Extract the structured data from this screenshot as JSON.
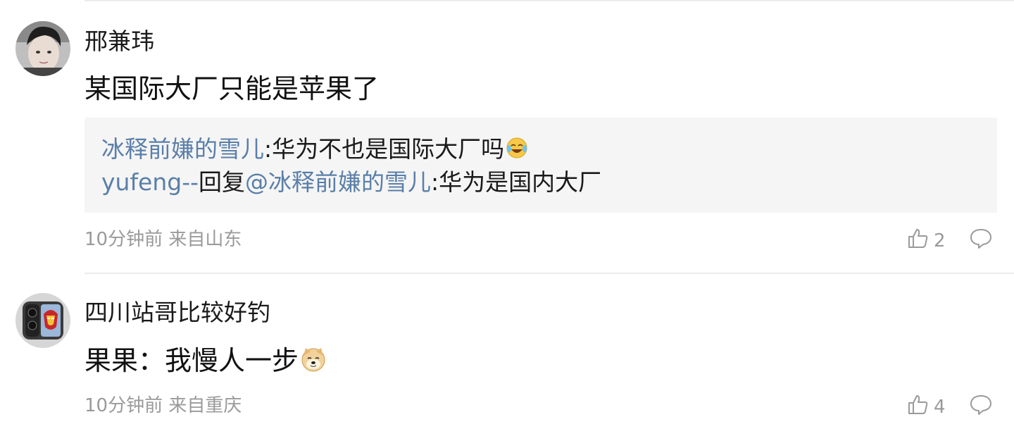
{
  "comments": [
    {
      "username": "邢兼玮",
      "text": "某国际大厂只能是苹果了",
      "replies": [
        {
          "author": "冰释前嫌的雪儿",
          "sep": ":",
          "text": "华为不也是国际大厂吗",
          "emoji": "laughing-crying-emoji"
        },
        {
          "author": "yufeng--",
          "mid": "回复",
          "mention": "@冰释前嫌的雪儿",
          "sep": ":",
          "text": "华为是国内大厂"
        }
      ],
      "time": "10分钟前",
      "location": "来自山东",
      "likes": "2"
    },
    {
      "username": "四川站哥比较好钓",
      "text": "果果：我慢人一步",
      "emoji": "doge-emoji",
      "time": "10分钟前",
      "location": "来自重庆",
      "likes": "4"
    }
  ],
  "colors": {
    "link": "#5a7fa8",
    "meta": "#9a9a9a",
    "replyBg": "#f5f5f5",
    "divider": "#ececec"
  }
}
